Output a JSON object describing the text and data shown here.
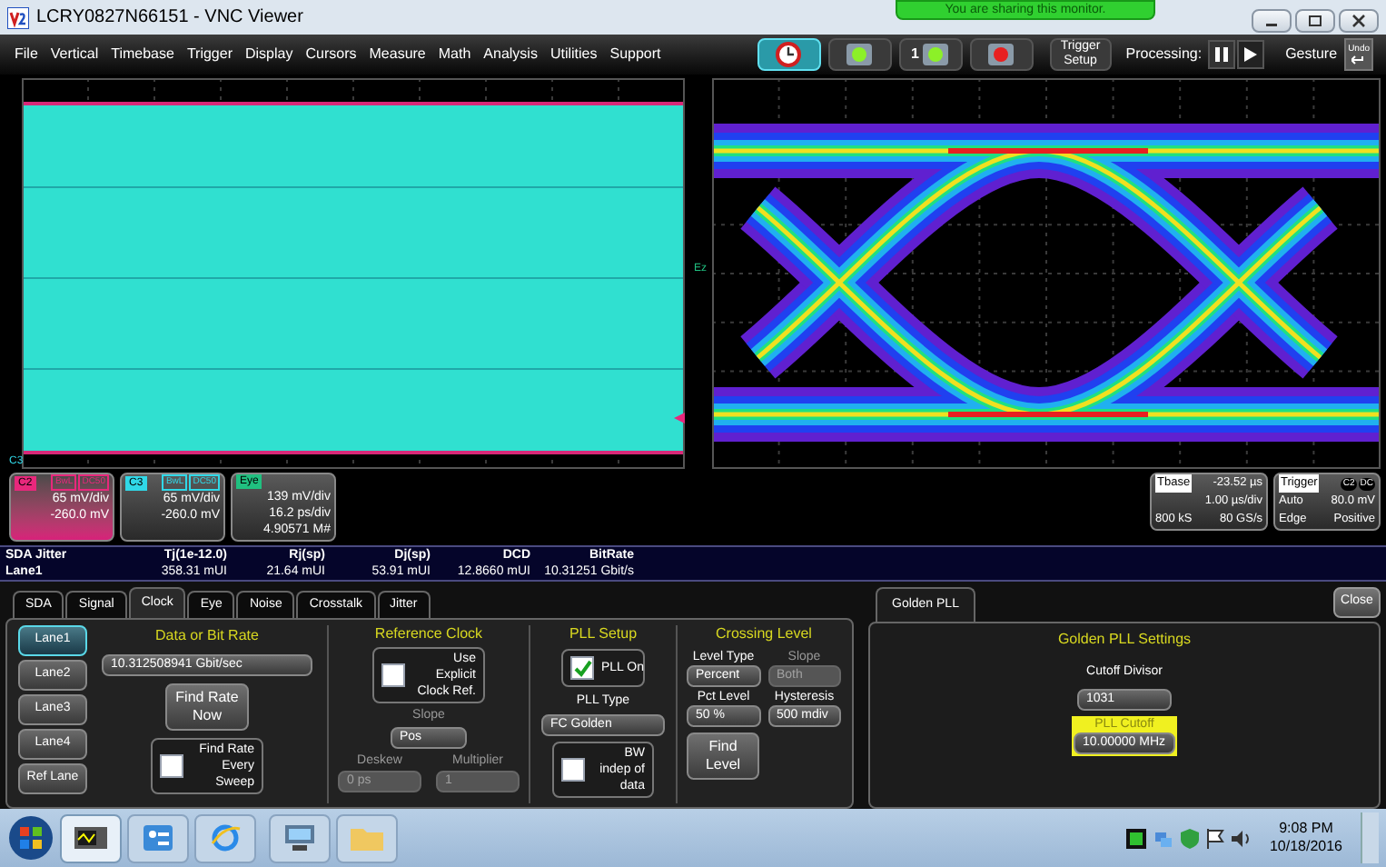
{
  "window": {
    "title": "LCRY0827N66151 - VNC Viewer"
  },
  "banner": "You are sharing this monitor.",
  "menu": [
    "File",
    "Vertical",
    "Timebase",
    "Trigger",
    "Display",
    "Cursors",
    "Measure",
    "Math",
    "Analysis",
    "Utilities",
    "Support"
  ],
  "toolbar": {
    "icon_buttons": [
      {
        "kind": "clock",
        "selected": true
      },
      {
        "kind": "green",
        "selected": false
      },
      {
        "kind": "green",
        "selected": false,
        "badge": "1"
      },
      {
        "kind": "red",
        "selected": false
      }
    ],
    "trigger_setup": "Trigger Setup",
    "processing_label": "Processing:",
    "gesture": "Gesture",
    "undo": "Undo"
  },
  "grid_labels": {
    "trace": "C3",
    "eye": "Ez"
  },
  "descriptors": [
    {
      "label": "C2",
      "color": "#e8287c",
      "tags": [
        "BwL",
        "DC50"
      ],
      "lines": [
        "65 mV/div",
        "-260.0 mV"
      ],
      "selected": true
    },
    {
      "label": "C3",
      "color": "#30d8e8",
      "tags": [
        "BwL",
        "DC50"
      ],
      "lines": [
        "65 mV/div",
        "-260.0 mV"
      ],
      "selected": false
    },
    {
      "label": "Eye",
      "color": "#20c080",
      "lines": [
        "139 mV/div",
        "16.2 ps/div",
        "4.90571 M#"
      ],
      "selected": false
    }
  ],
  "timebase": {
    "label": "Tbase",
    "offset": "-23.52 µs",
    "per_div": "1.00 µs/div",
    "samples": "800 kS",
    "rate": "80 GS/s"
  },
  "trigger": {
    "label": "Trigger",
    "tags": [
      "C2",
      "DC"
    ],
    "mode": "Auto",
    "threshold": "80.0 mV",
    "type": "Edge",
    "slope": "Positive"
  },
  "jitter_table": {
    "columns": [
      "SDA Jitter",
      "Tj(1e-12.0)",
      "Rj(sp)",
      "Dj(sp)",
      "DCD",
      "BitRate"
    ],
    "rows": [
      [
        "Lane1",
        "358.31 mUI",
        "21.64 mUI",
        "53.91 mUI",
        "12.8660 mUI",
        "10.31251 Gbit/s"
      ]
    ]
  },
  "tabs": [
    {
      "label": "SDA",
      "selected": false
    },
    {
      "label": "Signal",
      "selected": false
    },
    {
      "label": "Clock",
      "selected": true
    },
    {
      "label": "Eye",
      "selected": false
    },
    {
      "label": "Noise",
      "selected": false
    },
    {
      "label": "Crosstalk",
      "selected": false
    },
    {
      "label": "Jitter",
      "selected": false
    }
  ],
  "lanes": [
    {
      "label": "Lane1",
      "selected": true
    },
    {
      "label": "Lane2",
      "selected": false
    },
    {
      "label": "Lane3",
      "selected": false
    },
    {
      "label": "Lane4",
      "selected": false
    },
    {
      "label": "Ref Lane",
      "selected": false
    }
  ],
  "data_rate": {
    "title": "Data or Bit Rate",
    "value": "10.312508941 Gbit/sec",
    "find_button": "Find Rate Now",
    "every_sweep": {
      "label": "Find Rate Every Sweep",
      "checked": false
    }
  },
  "reference_clock": {
    "title": "Reference Clock",
    "use_explicit": {
      "label": "Use Explicit Clock Ref.",
      "checked": false
    },
    "slope": {
      "label": "Slope",
      "value": "Pos",
      "disabled": false
    },
    "deskew": {
      "label": "Deskew",
      "value": "0 ps",
      "disabled": true
    },
    "multiplier": {
      "label": "Multiplier",
      "value": "1",
      "disabled": true
    }
  },
  "pll_setup": {
    "title": "PLL Setup",
    "pll_on": {
      "label": "PLL On",
      "checked": true
    },
    "type": {
      "label": "PLL Type",
      "value": "FC Golden",
      "disabled": false
    },
    "bw_indep": {
      "label": "BW indep of data",
      "checked": false
    }
  },
  "crossing_level": {
    "title": "Crossing Level",
    "fields": [
      {
        "label": "Level Type",
        "value": "Percent",
        "disabled": false
      },
      {
        "label": "Slope",
        "value": "Both",
        "disabled": true
      },
      {
        "label": "Pct Level",
        "value": "50 %",
        "disabled": false
      },
      {
        "label": "Hysteresis",
        "value": "500 mdiv",
        "disabled": false
      }
    ],
    "find_button": "Find Level"
  },
  "right_panel": {
    "tabs": [
      {
        "label": "Golden PLL",
        "selected": true
      }
    ],
    "close": "Close",
    "title": "Golden PLL Settings",
    "cutoff_divisor": {
      "label": "Cutoff Divisor",
      "value": "1031"
    },
    "pll_cutoff": {
      "label": "PLL Cutoff",
      "value": "10.00000 MHz",
      "highlighted": true
    }
  },
  "taskbar": {
    "apps": [
      {
        "kind": "scope",
        "selected": true
      },
      {
        "kind": "panel",
        "selected": false
      },
      {
        "kind": "browser",
        "selected": false
      },
      {
        "kind": "network",
        "selected": false
      },
      {
        "kind": "folder",
        "selected": false
      }
    ],
    "time": "9:08 PM",
    "date": "10/18/2016"
  }
}
